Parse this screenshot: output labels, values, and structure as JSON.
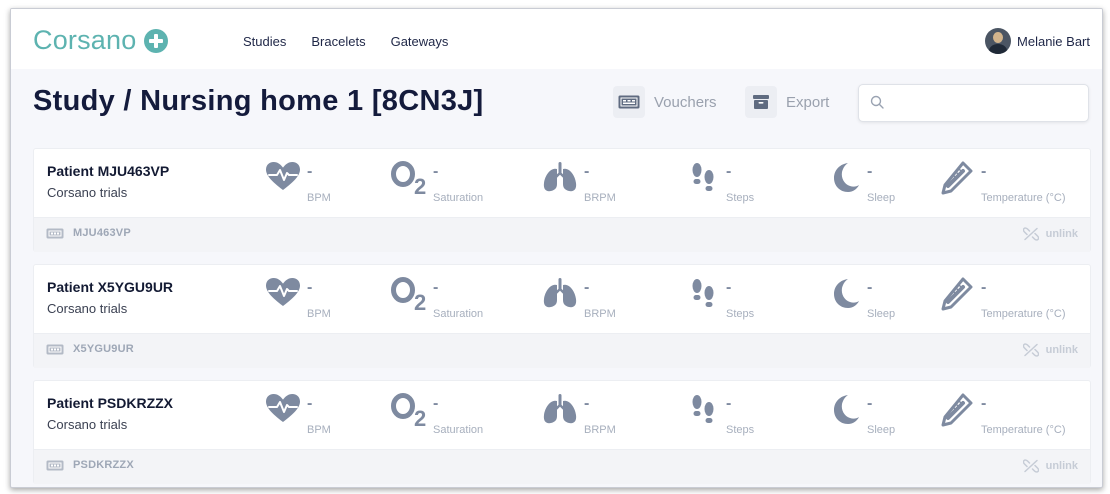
{
  "brand": {
    "name": "Corsano",
    "accent": "#5db3b0"
  },
  "nav": {
    "items": [
      "Studies",
      "Bracelets",
      "Gateways"
    ]
  },
  "user": {
    "name": "Melanie Bart"
  },
  "page": {
    "title": "Study / Nursing home 1 [8CN3J]",
    "vouchers_label": "Vouchers",
    "export_label": "Export",
    "search_placeholder": "",
    "search_value": ""
  },
  "metric_icons": [
    "heart-icon",
    "oxygen-icon",
    "lungs-icon",
    "footsteps-icon",
    "moon-icon",
    "thermometer-icon"
  ],
  "patients": [
    {
      "name": "Patient MJU463VP",
      "group": "Corsano trials",
      "device_id": "MJU463VP",
      "unlink_label": "unlink",
      "metrics": [
        {
          "value": "-",
          "unit": "BPM"
        },
        {
          "value": "-",
          "unit": "Saturation"
        },
        {
          "value": "-",
          "unit": "BRPM"
        },
        {
          "value": "-",
          "unit": "Steps"
        },
        {
          "value": "-",
          "unit": "Sleep"
        },
        {
          "value": "-",
          "unit": "Temperature (°C)"
        }
      ]
    },
    {
      "name": "Patient X5YGU9UR",
      "group": "Corsano trials",
      "device_id": "X5YGU9UR",
      "unlink_label": "unlink",
      "metrics": [
        {
          "value": "-",
          "unit": "BPM"
        },
        {
          "value": "-",
          "unit": "Saturation"
        },
        {
          "value": "-",
          "unit": "BRPM"
        },
        {
          "value": "-",
          "unit": "Steps"
        },
        {
          "value": "-",
          "unit": "Sleep"
        },
        {
          "value": "-",
          "unit": "Temperature (°C)"
        }
      ]
    },
    {
      "name": "Patient PSDKRZZX",
      "group": "Corsano trials",
      "device_id": "PSDKRZZX",
      "unlink_label": "unlink",
      "metrics": [
        {
          "value": "-",
          "unit": "BPM"
        },
        {
          "value": "-",
          "unit": "Saturation"
        },
        {
          "value": "-",
          "unit": "BRPM"
        },
        {
          "value": "-",
          "unit": "Steps"
        },
        {
          "value": "-",
          "unit": "Sleep"
        },
        {
          "value": "-",
          "unit": "Temperature (°C)"
        }
      ]
    }
  ]
}
